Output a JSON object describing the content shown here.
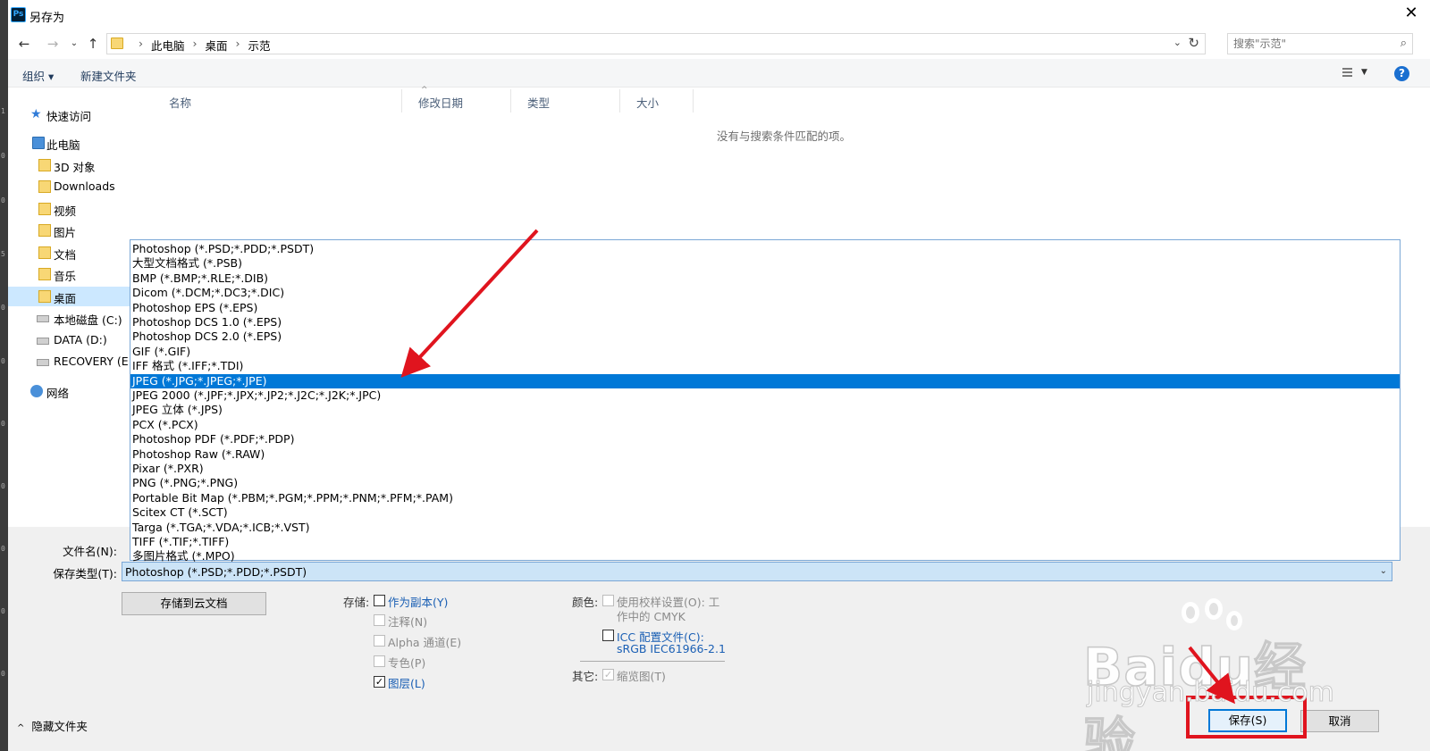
{
  "window": {
    "title": "另存为",
    "app_icon_label": "Ps",
    "close_glyph": "✕"
  },
  "nav": {
    "path": [
      "此电脑",
      "桌面",
      "示范"
    ],
    "search_placeholder": "搜索\"示范\""
  },
  "toolbar": {
    "organize_label": "组织 ▾",
    "new_folder_label": "新建文件夹"
  },
  "sidebar": {
    "items": [
      {
        "label": "快速访问"
      },
      {
        "label": "此电脑"
      },
      {
        "label": "3D 对象"
      },
      {
        "label": "Downloads"
      },
      {
        "label": "视频"
      },
      {
        "label": "图片"
      },
      {
        "label": "文档"
      },
      {
        "label": "音乐"
      },
      {
        "label": "桌面"
      },
      {
        "label": "本地磁盘 (C:)"
      },
      {
        "label": "DATA (D:)"
      },
      {
        "label": "RECOVERY (E:)"
      },
      {
        "label": "网络"
      }
    ]
  },
  "file_list": {
    "columns": [
      "名称",
      "修改日期",
      "类型",
      "大小"
    ],
    "empty_message": "没有与搜索条件匹配的项。"
  },
  "fields": {
    "filename_label": "文件名(N):",
    "filetype_label": "保存类型(T):",
    "filetype_value": "Photoshop (*.PSD;*.PDD;*.PSDT)"
  },
  "dropdown": {
    "selected_index": 9,
    "options": [
      "Photoshop (*.PSD;*.PDD;*.PSDT)",
      "大型文档格式 (*.PSB)",
      "BMP (*.BMP;*.RLE;*.DIB)",
      "Dicom (*.DCM;*.DC3;*.DIC)",
      "Photoshop EPS (*.EPS)",
      "Photoshop DCS 1.0 (*.EPS)",
      "Photoshop DCS 2.0 (*.EPS)",
      "GIF (*.GIF)",
      "IFF 格式 (*.IFF;*.TDI)",
      "JPEG (*.JPG;*.JPEG;*.JPE)",
      "JPEG 2000 (*.JPF;*.JPX;*.JP2;*.J2C;*.J2K;*.JPC)",
      "JPEG 立体 (*.JPS)",
      "PCX (*.PCX)",
      "Photoshop PDF (*.PDF;*.PDP)",
      "Photoshop Raw (*.RAW)",
      "Pixar (*.PXR)",
      "PNG (*.PNG;*.PNG)",
      "Portable Bit Map (*.PBM;*.PGM;*.PPM;*.PNM;*.PFM;*.PAM)",
      "Scitex CT (*.SCT)",
      "Targa (*.TGA;*.VDA;*.ICB;*.VST)",
      "TIFF (*.TIF;*.TIFF)",
      "多图片格式 (*.MPO)"
    ]
  },
  "options": {
    "cloud_button": "存储到云文档",
    "save_label": "存储:",
    "as_copy": "作为副本(Y)",
    "notes": "注释(N)",
    "alpha": "Alpha 通道(E)",
    "spot": "专色(P)",
    "layers": "图层(L)",
    "color_label": "颜色:",
    "proof_line1": "使用校样设置(O): 工",
    "proof_line2": "作中的 CMYK",
    "icc_line1": "ICC 配置文件(C):",
    "icc_line2": "sRGB IEC61966-2.1",
    "other_label": "其它:",
    "thumbnail": "缩览图(T)",
    "layers_checked": "✓",
    "thumbnail_checked": "✓"
  },
  "footer": {
    "hide_folders": "隐藏文件夹",
    "save_button": "保存(S)",
    "cancel_button": "取消"
  },
  "watermark": {
    "brand": "Baidu经验",
    "url": "jingyan.baidu.com"
  },
  "colors": {
    "selection": "#0078d7",
    "annotation_red": "#e0141e",
    "link": "#1a5fb4"
  }
}
